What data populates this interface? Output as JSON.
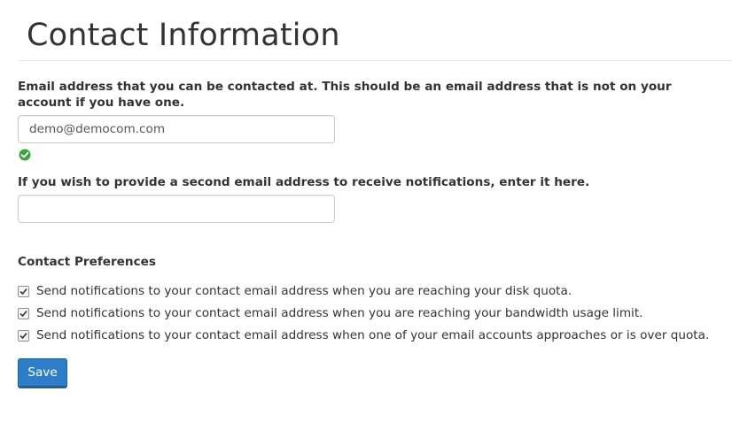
{
  "page": {
    "title": "Contact Information"
  },
  "contact_email": {
    "label": "Email address that you can be contacted at. This should be an email address that is not on your account if you have one.",
    "value": "demo@democom.com",
    "placeholder": "",
    "status_icon": "check-circle-icon",
    "status_color": "#3aa53a"
  },
  "second_email": {
    "label": "If you wish to provide a second email address to receive notifications, enter it here.",
    "value": "",
    "placeholder": ""
  },
  "preferences": {
    "heading": "Contact Preferences",
    "items": [
      {
        "label": "Send notifications to your contact email address when you are reaching your disk quota.",
        "checked": true
      },
      {
        "label": "Send notifications to your contact email address when you are reaching your bandwidth usage limit.",
        "checked": true
      },
      {
        "label": "Send notifications to your contact email address when one of your email accounts approaches or is over quota.",
        "checked": true
      }
    ]
  },
  "actions": {
    "save_label": "Save",
    "save_color": "#2d7dc8"
  }
}
